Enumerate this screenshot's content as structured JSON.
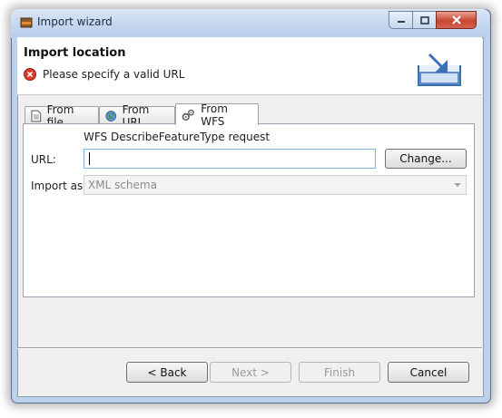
{
  "window": {
    "title": "Import wizard"
  },
  "header": {
    "title": "Import location",
    "message": "Please specify a valid URL"
  },
  "tabs": [
    {
      "label": "From file",
      "icon": "file-icon",
      "active": false
    },
    {
      "label": "From URL",
      "icon": "globe-icon",
      "active": false
    },
    {
      "label": "From WFS",
      "icon": "gears-icon",
      "active": true
    }
  ],
  "form": {
    "request_label": "WFS DescribeFeatureType request",
    "url_label": "URL:",
    "url_value": "",
    "change_label": "Change...",
    "import_as_label": "Import as",
    "import_as_value": "XML schema"
  },
  "buttons": {
    "back": "< Back",
    "next": "Next >",
    "finish": "Finish",
    "cancel": "Cancel"
  },
  "colors": {
    "error": "#d83b2a",
    "accent": "#3b6fb6"
  }
}
